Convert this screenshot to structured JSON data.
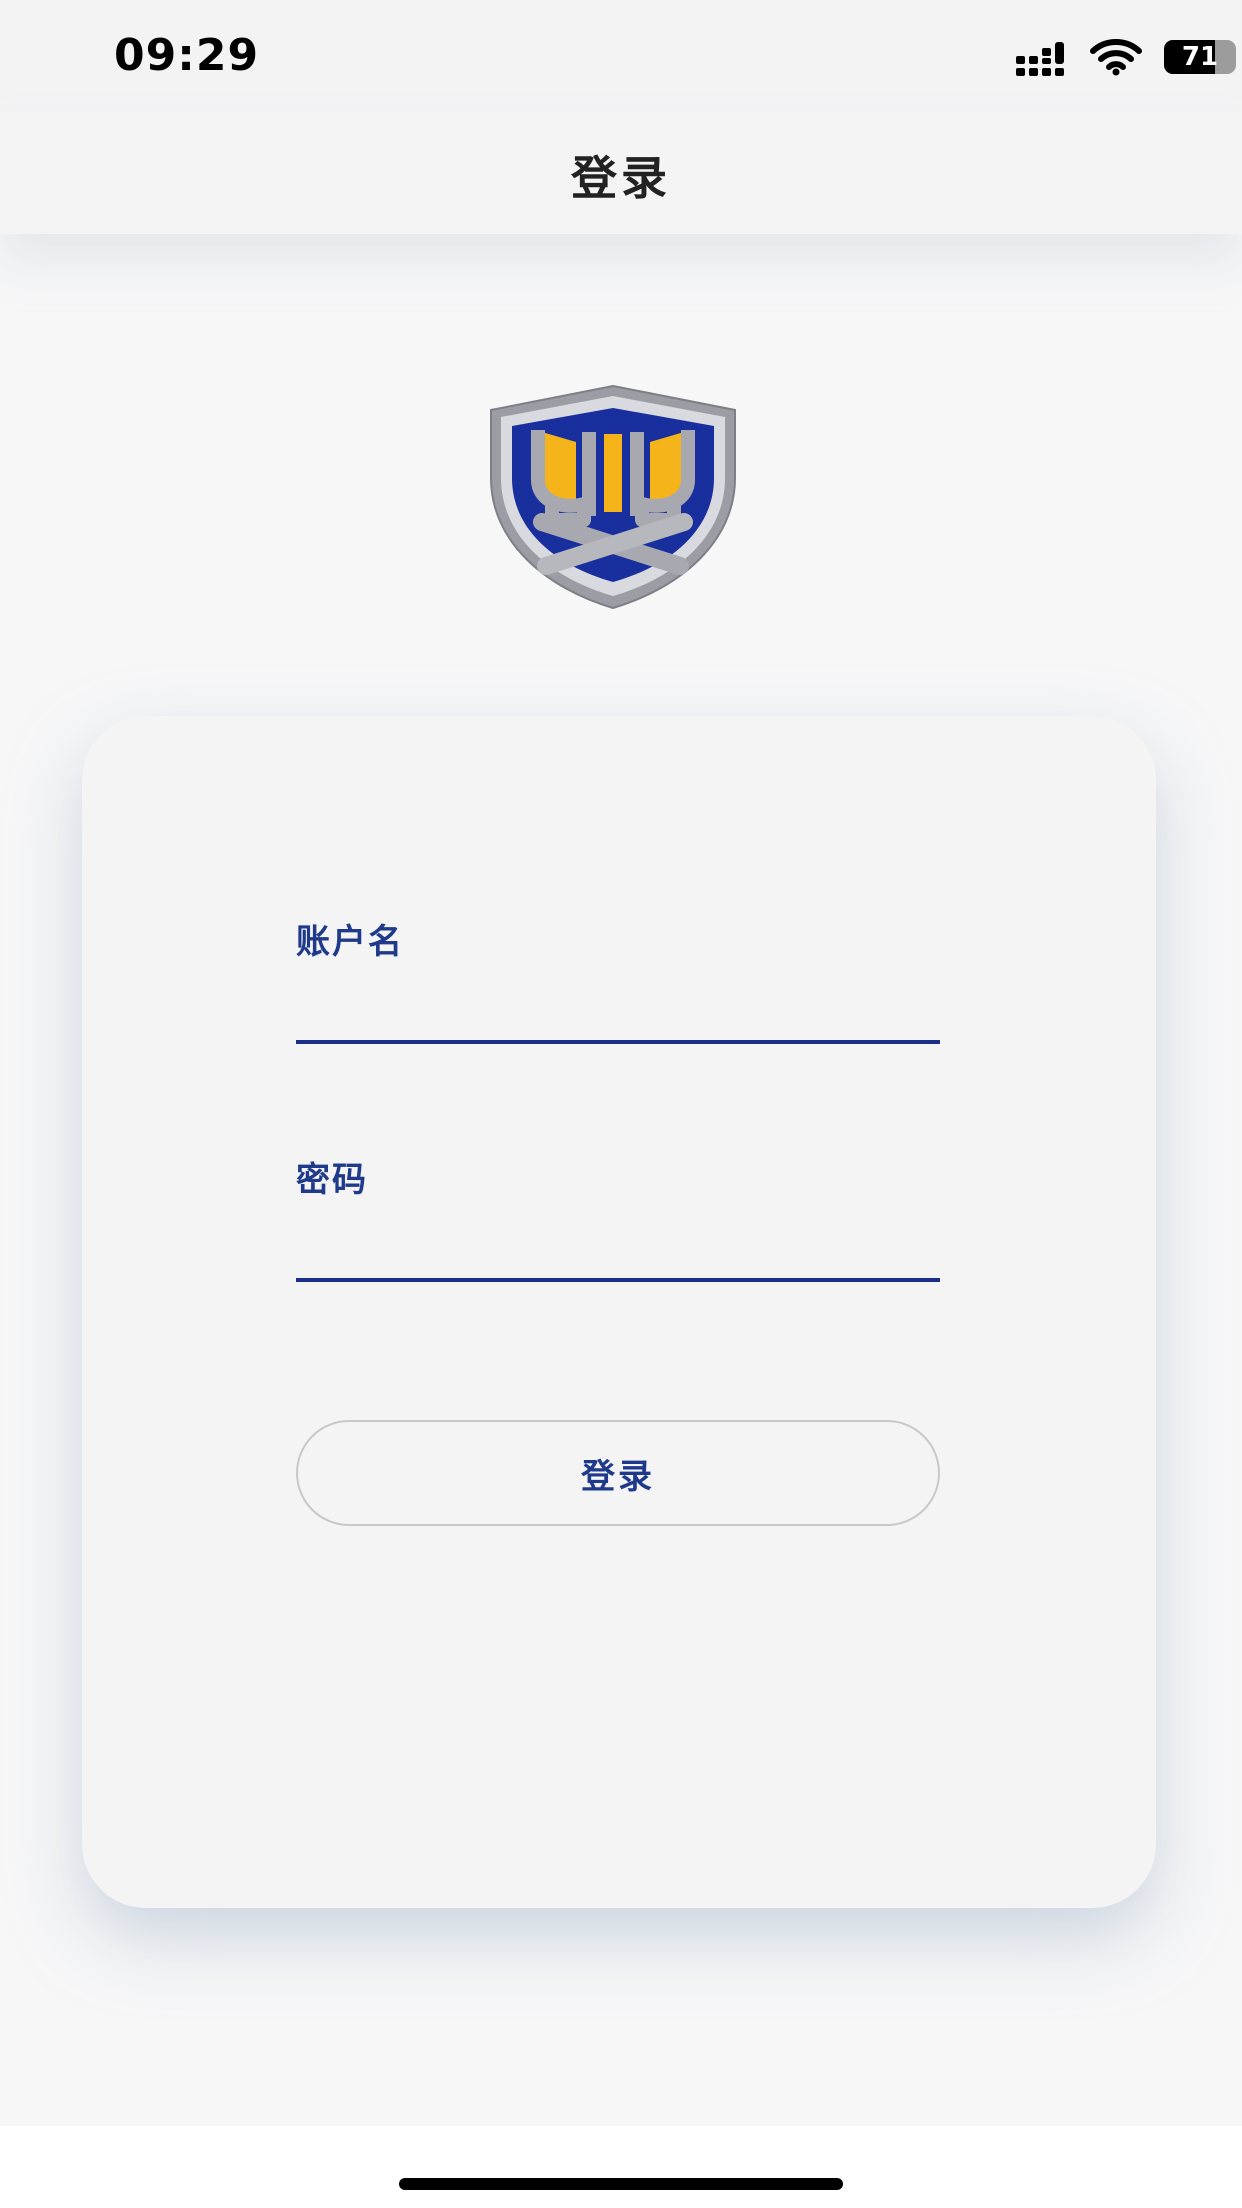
{
  "status_bar": {
    "time": "09:29",
    "battery": "71",
    "battery_level": 0.71,
    "icons": [
      "signal-icon",
      "wifi-icon",
      "battery-icon"
    ]
  },
  "nav": {
    "title": "登录"
  },
  "logo": {
    "icon": "shield-logo-icon",
    "colors": {
      "blue": "#1a2f9e",
      "gold": "#f5b41a",
      "silver": "#a9aab0"
    }
  },
  "form": {
    "username_label": "账户名",
    "username_value": "",
    "password_label": "密码",
    "password_value": "",
    "submit_label": "登录"
  },
  "colors": {
    "accent": "#1f3a8a",
    "background": "#f7f7f8",
    "card": "#f4f4f5"
  }
}
